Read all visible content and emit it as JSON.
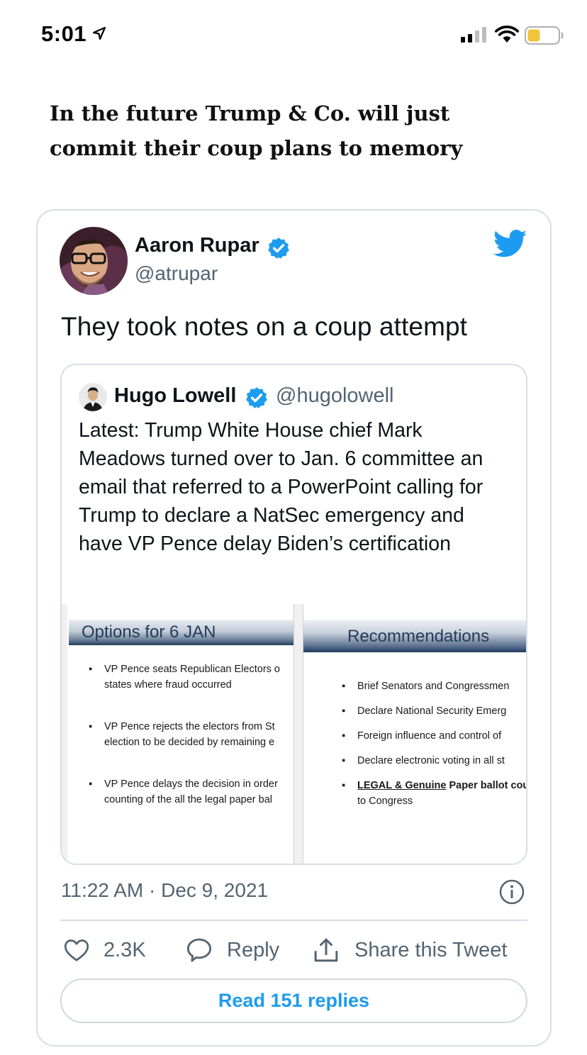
{
  "status_bar": {
    "time": "5:01",
    "icons": [
      "location-arrow-icon",
      "cellular-signal-icon",
      "wifi-icon",
      "battery-icon"
    ]
  },
  "headline": "In the future Trump & Co. will just commit their coup plans to memory",
  "tweet": {
    "author": {
      "name": "Aaron Rupar",
      "handle": "@atrupar",
      "verified": true
    },
    "text": "They took notes on a coup attempt",
    "quoted": {
      "author": {
        "name": "Hugo Lowell",
        "handle": "@hugolowell",
        "verified": true
      },
      "text": "Latest: Trump White House chief Mark Meadows turned over to Jan. 6 committee an email that referred to a PowerPoint calling for Trump to declare a NatSec emergency and have VP Pence delay Biden’s certification",
      "slides": [
        {
          "title": "Options for 6 JAN",
          "bullets": [
            [
              "VP Pence seats Republican Electors o",
              "states where fraud occurred"
            ],
            [
              "VP Pence rejects the electors from St",
              "election to be decided by remaining e"
            ],
            [
              "VP Pence delays the decision in order",
              "counting of the all the legal paper bal"
            ]
          ]
        },
        {
          "title": "Recommendations",
          "bullets": [
            "Brief Senators and Congressmen",
            "Declare National Security Emerg",
            "Foreign influence and control of",
            "Declare electronic voting in all st"
          ],
          "last_bullet": {
            "underlined": "LEGAL & Genuine",
            "bold": "Paper ballot cour",
            "line2": "to Congress"
          }
        }
      ]
    },
    "timestamp": "11:22 AM · Dec 9, 2021",
    "actions": {
      "likes": "2.3K",
      "reply": "Reply",
      "share": "Share this Tweet"
    },
    "read_replies": "Read 151 replies",
    "colors": {
      "accent": "#1d9bf0",
      "secondary_text": "#536471",
      "border": "#d8dee3"
    }
  }
}
